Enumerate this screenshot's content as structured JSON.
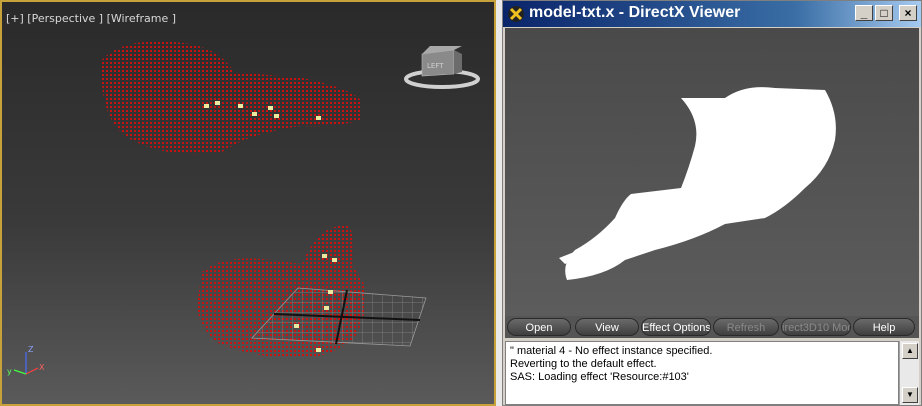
{
  "viewport": {
    "label": "[+] [Perspective ] [Wireframe ]",
    "viewcube_face": "LEFT",
    "axis": {
      "z": "Z",
      "y": "y",
      "x": "X"
    }
  },
  "dx": {
    "title": "model-txt.x - DirectX Viewer",
    "caption_buttons": {
      "minimize": "_",
      "maximize": "□",
      "close": "×"
    },
    "toolbar": [
      {
        "label": "Open",
        "enabled": true
      },
      {
        "label": "View",
        "enabled": true
      },
      {
        "label": "Effect Options",
        "enabled": true
      },
      {
        "label": "Refresh",
        "enabled": false
      },
      {
        "label": "irect3D10 Mod",
        "enabled": false
      },
      {
        "label": "Help",
        "enabled": true
      }
    ],
    "log_lines": [
      "\" material 4 - No effect instance specified.",
      "Reverting to the default effect.",
      "SAS: Loading effect 'Resource:#103'"
    ],
    "scroll": {
      "up": "▲",
      "down": "▼"
    }
  },
  "colors": {
    "accent_border": "#c7a23a",
    "wire": "#cc1111",
    "titlebar": "#0a246a"
  }
}
